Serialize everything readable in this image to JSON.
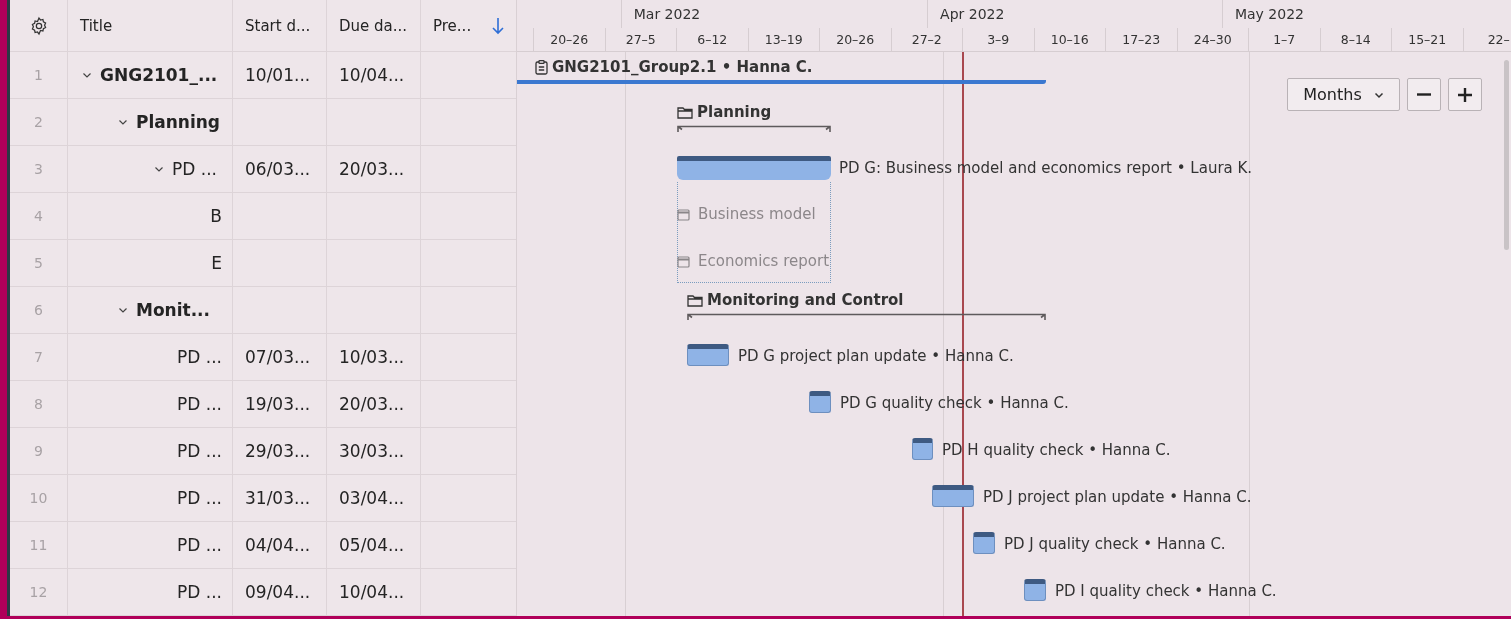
{
  "table": {
    "columns": [
      {
        "label": "Title"
      },
      {
        "label": "Start d..."
      },
      {
        "label": "Due da..."
      },
      {
        "label": "Pre..."
      }
    ],
    "rows": [
      {
        "number": "1",
        "title": "GNG2101_...",
        "start": "10/01...",
        "due": "10/04...",
        "expanded": true,
        "children": [
          {
            "number": "2",
            "title": "Planning",
            "expanded": true,
            "children": [
              {
                "number": "3",
                "title": "PD ...",
                "start": "06/03...",
                "due": "20/03...",
                "expanded": true,
                "children": [
                  {
                    "number": "4",
                    "title": "B"
                  },
                  {
                    "number": "5",
                    "title": "E"
                  }
                ]
              }
            ]
          },
          {
            "number": "6",
            "title": "Monit...",
            "expanded": true,
            "children": [
              {
                "number": "7",
                "title": "PD ...",
                "start": "07/03...",
                "due": "10/03..."
              },
              {
                "number": "8",
                "title": "PD ...",
                "start": "19/03...",
                "due": "20/03..."
              },
              {
                "number": "9",
                "title": "PD ...",
                "start": "29/03...",
                "due": "30/03..."
              },
              {
                "number": "10",
                "title": "PD ...",
                "start": "31/03...",
                "due": "03/04..."
              },
              {
                "number": "11",
                "title": "PD ...",
                "start": "04/04...",
                "due": "05/04..."
              },
              {
                "number": "12",
                "title": "PD ...",
                "start": "09/04...",
                "due": "10/04..."
              }
            ]
          }
        ]
      }
    ]
  },
  "timeline": {
    "months": [
      "Mar 2022",
      "Apr 2022",
      "May 2022"
    ],
    "weeks": [
      "20–26",
      "27–5",
      "6–12",
      "13–19",
      "20–26",
      "27–2",
      "3–9",
      "10–16",
      "17–23",
      "24–30",
      "1–7",
      "8–14",
      "15–21",
      "22–"
    ],
    "timescale": "Months"
  },
  "gantt": [
    {
      "kind": "project",
      "label": "GNG2101_Group2.1 • Hanna C.",
      "children": [
        {
          "kind": "group",
          "label": "Planning",
          "children": [
            {
              "kind": "summary",
              "label": "PD G: Business model and economics report • Laura K.",
              "children": [
                {
                  "kind": "subtask",
                  "label": "Business model"
                },
                {
                  "kind": "subtask",
                  "label": "Economics report"
                }
              ]
            }
          ]
        },
        {
          "kind": "group",
          "label": "Monitoring and Control",
          "children": [
            {
              "kind": "task",
              "label": "PD G project plan update • Hanna C."
            },
            {
              "kind": "task",
              "label": "PD G quality check • Hanna C."
            },
            {
              "kind": "task",
              "label": "PD H quality check • Hanna C."
            },
            {
              "kind": "task",
              "label": "PD J project plan update • Hanna C."
            },
            {
              "kind": "task",
              "label": "PD J quality check • Hanna C."
            },
            {
              "kind": "task",
              "label": "PD I quality check • Hanna C."
            }
          ]
        }
      ]
    }
  ]
}
